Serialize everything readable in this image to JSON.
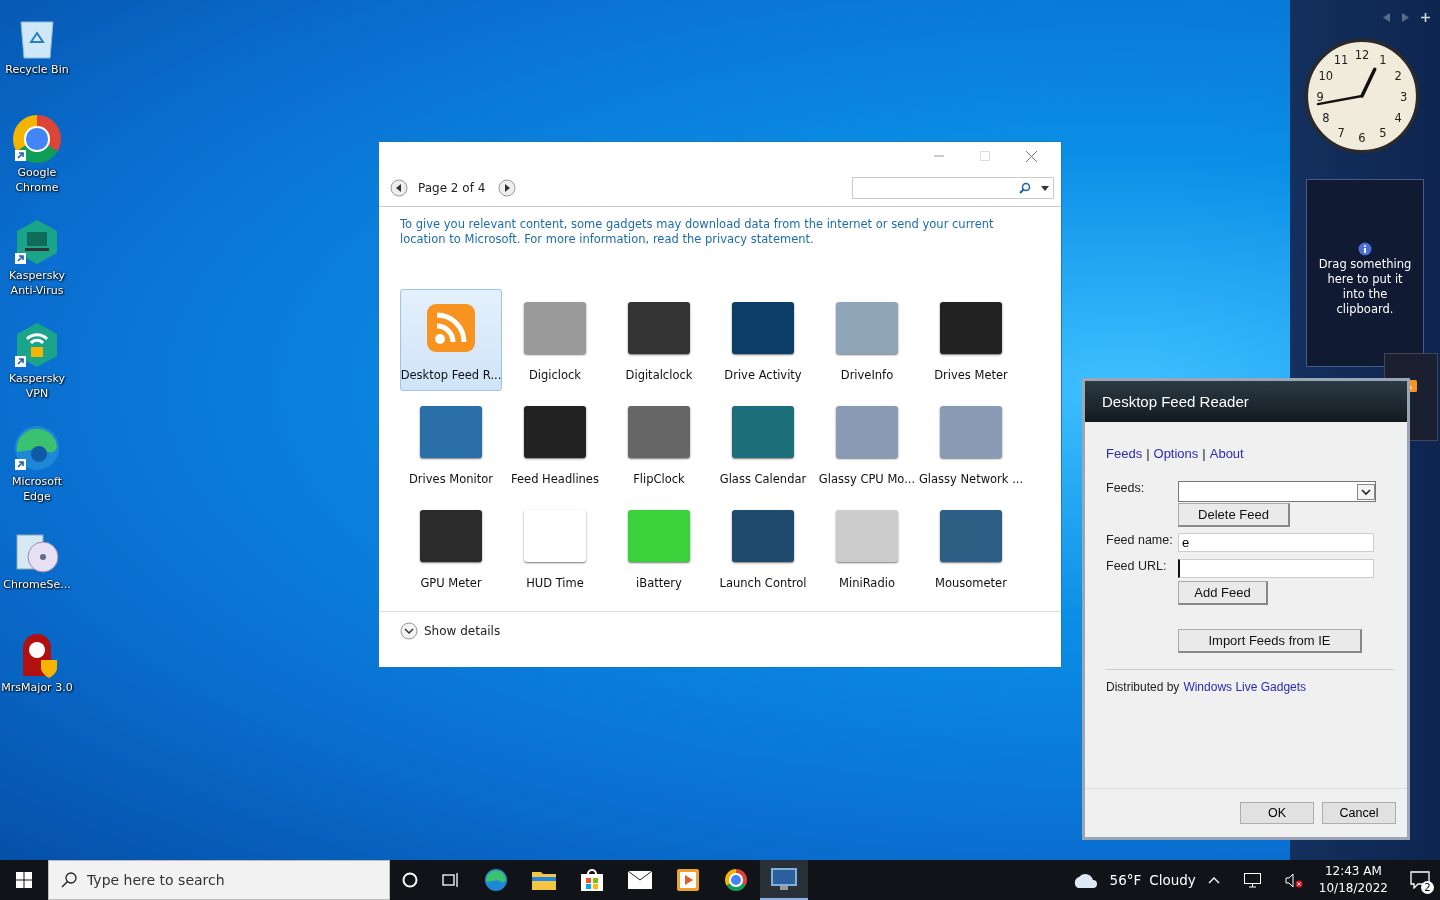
{
  "desktop_icons": [
    {
      "kind": "recycle-bin",
      "label": "Recycle Bin",
      "shortcut": false
    },
    {
      "kind": "chrome",
      "label": "Google Chrome",
      "shortcut": true
    },
    {
      "kind": "kaspersky",
      "label": "Kaspersky Anti-Virus",
      "shortcut": true
    },
    {
      "kind": "vpn",
      "label": "Kaspersky VPN",
      "shortcut": true
    },
    {
      "kind": "edge",
      "label": "Microsoft Edge",
      "shortcut": true
    },
    {
      "kind": "installer",
      "label": "ChromeSe...",
      "shortcut": false
    },
    {
      "kind": "mask",
      "label": "MrsMajor 3.0",
      "shortcut": false
    }
  ],
  "gadget_window": {
    "page_label": "Page 2 of 4",
    "notice": "To give you relevant content, some gadgets may download data from the internet or send your current location to Microsoft. For more information, read the privacy statement.",
    "gadgets": [
      {
        "name": "Desktop Feed R...",
        "selected": true
      },
      {
        "name": "Digiclock",
        "selected": false
      },
      {
        "name": "Digitalclock",
        "selected": false
      },
      {
        "name": "Drive Activity",
        "selected": false
      },
      {
        "name": "DriveInfo",
        "selected": false
      },
      {
        "name": "Drives Meter",
        "selected": false
      },
      {
        "name": "Drives Monitor",
        "selected": false
      },
      {
        "name": "Feed Headlines",
        "selected": false
      },
      {
        "name": "FlipClock",
        "selected": false
      },
      {
        "name": "Glass Calendar",
        "selected": false
      },
      {
        "name": "Glassy CPU Mo...",
        "selected": false
      },
      {
        "name": "Glassy Network ...",
        "selected": false
      },
      {
        "name": "GPU Meter",
        "selected": false
      },
      {
        "name": "HUD Time",
        "selected": false
      },
      {
        "name": "iBattery",
        "selected": false
      },
      {
        "name": "Launch Control",
        "selected": false
      },
      {
        "name": "MiniRadio",
        "selected": false
      },
      {
        "name": "Mousometer",
        "selected": false
      }
    ],
    "details_toggle": "Show details"
  },
  "sidebar": {
    "clock": {
      "numerals": [
        "12",
        "1",
        "2",
        "3",
        "4",
        "5",
        "6",
        "7",
        "8",
        "9",
        "10",
        "11"
      ]
    },
    "clipboard_gadget": {
      "message": "Drag something here to put it into the clipboard."
    }
  },
  "feed_dialog": {
    "title": "Desktop Feed Reader",
    "tabs": [
      {
        "label": "Feeds"
      },
      {
        "label": "Options"
      },
      {
        "label": "About"
      }
    ],
    "tab_separators": [
      "|",
      "|"
    ],
    "feeds_label": "Feeds:",
    "delete_button": "Delete Feed",
    "name_label": "Feed name:",
    "name_value": "e",
    "url_label": "Feed URL:",
    "add_button": "Add Feed",
    "import_button": "Import Feeds from IE",
    "credit_text": "Distributed by",
    "credit_link": "Windows Live Gadgets",
    "ok_button": "OK",
    "cancel_button": "Cancel"
  },
  "taskbar": {
    "search_placeholder": "Type here to search",
    "apps": [
      {
        "kind": "edge",
        "active": false
      },
      {
        "kind": "folder",
        "active": false
      },
      {
        "kind": "store",
        "active": false
      },
      {
        "kind": "mail",
        "active": false
      },
      {
        "kind": "media",
        "active": false
      },
      {
        "kind": "chrome",
        "active": false
      },
      {
        "kind": "gadgets",
        "active": true
      }
    ],
    "temperature": "56°F",
    "condition": "Cloudy",
    "time": "12:43 AM",
    "date": "10/18/2022",
    "notification_count": "2"
  }
}
